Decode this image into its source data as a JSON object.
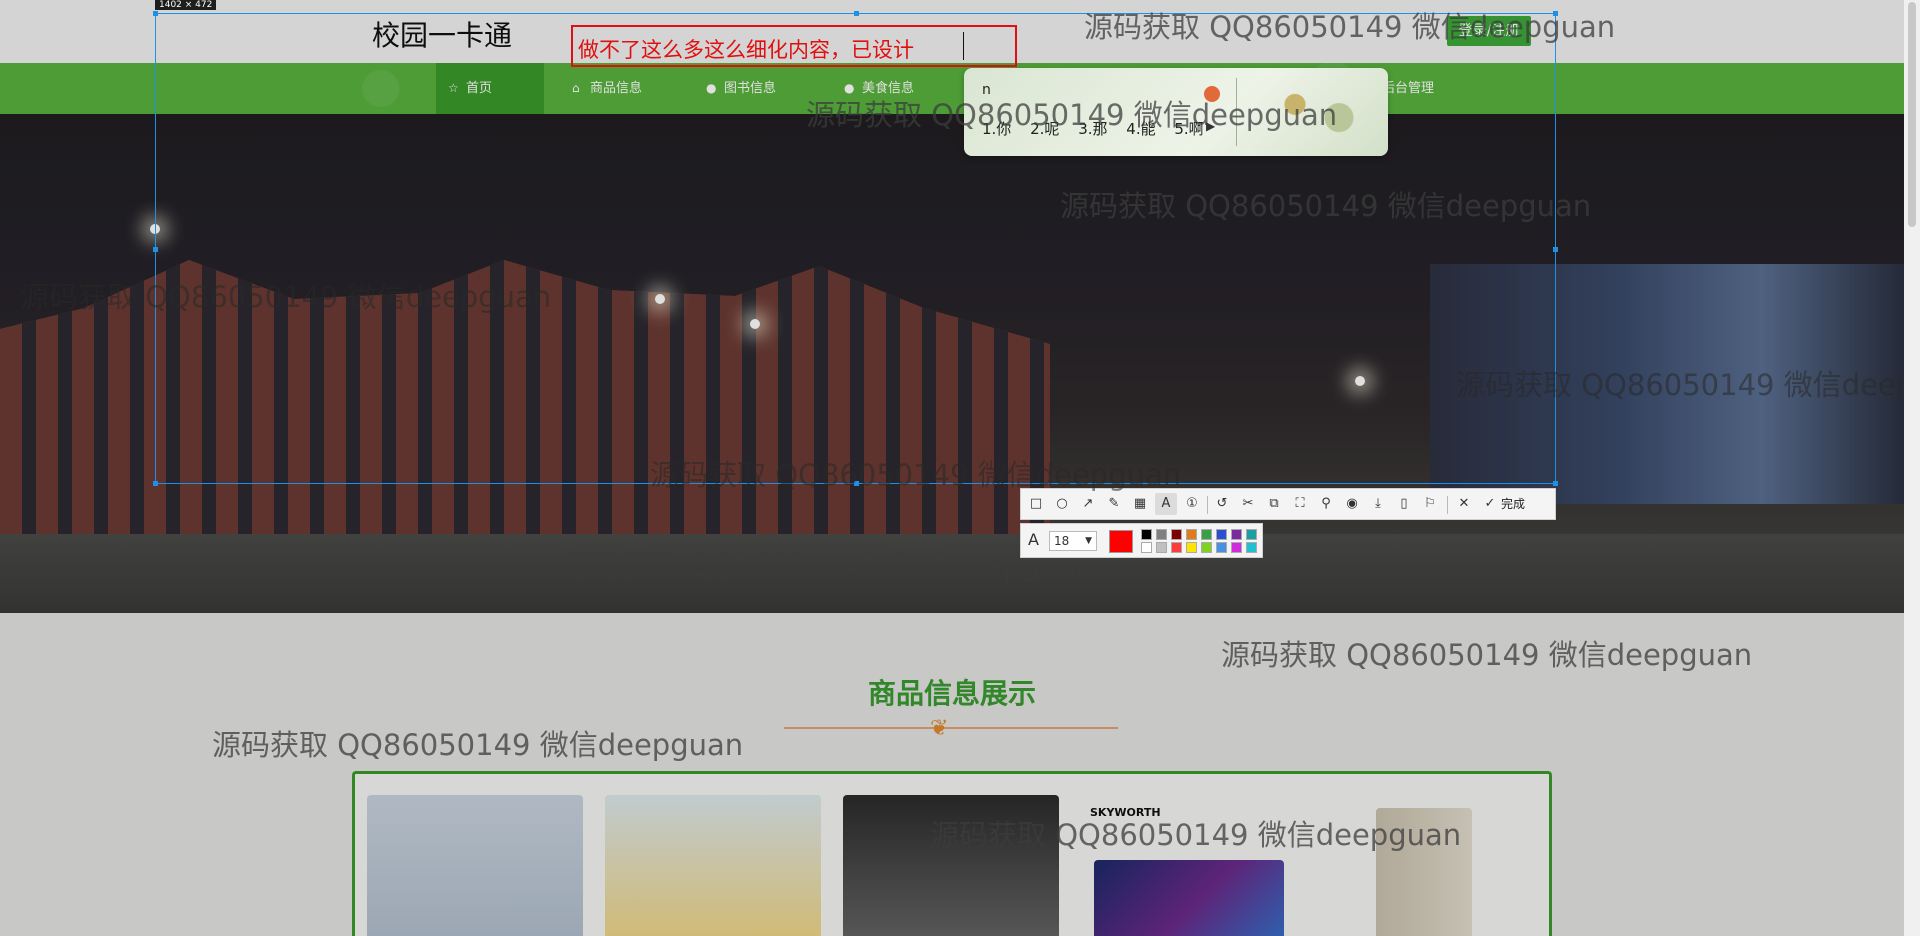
{
  "site": {
    "brand": "校园一卡通",
    "login_label": "登录/注册",
    "nav": [
      {
        "label": "首页",
        "icon": "star-icon",
        "active": true
      },
      {
        "label": "商品信息",
        "icon": "home-icon"
      },
      {
        "label": "图书信息",
        "icon": "info-icon"
      },
      {
        "label": "美食信息",
        "icon": "info-icon"
      },
      {
        "label": "后台管理",
        "icon": "gear-icon"
      }
    ],
    "section_title": "商品信息展示",
    "goods_brand_text": "SKYWORTH"
  },
  "screenshot_tool": {
    "selection_size": "1402 × 472",
    "text_annotation": "做不了这么多这么细化内容，已设计",
    "ime": {
      "composition": "n",
      "candidates": [
        "1.你",
        "2.呢",
        "3.那",
        "4.能",
        "5.啊"
      ]
    },
    "toolbar": {
      "tools": [
        "rectangle-icon",
        "ellipse-icon",
        "arrow-icon",
        "pen-icon",
        "mosaic-icon",
        "text-icon",
        "number-icon",
        "undo-icon",
        "cut-icon",
        "copy-icon",
        "ocr-icon",
        "pin-icon",
        "record-icon",
        "download-icon",
        "long-screenshot-icon",
        "bookmark-icon",
        "close-icon"
      ],
      "done_label": "完成"
    },
    "text_options": {
      "font_size": "18",
      "current_color": "#ff0000",
      "palette": [
        "#000000",
        "#808080",
        "#800000",
        "#e07b1a",
        "#3aa047",
        "#2a4fd1",
        "#7a2aa0",
        "#1aa0a0",
        "#ffffff",
        "#c0c0c0",
        "#ff3b3b",
        "#ffe400",
        "#7ed321",
        "#4a90e2",
        "#d12ae0",
        "#20c0d0"
      ]
    }
  },
  "watermark": "源码获取 QQ86050149 微信deepguan"
}
